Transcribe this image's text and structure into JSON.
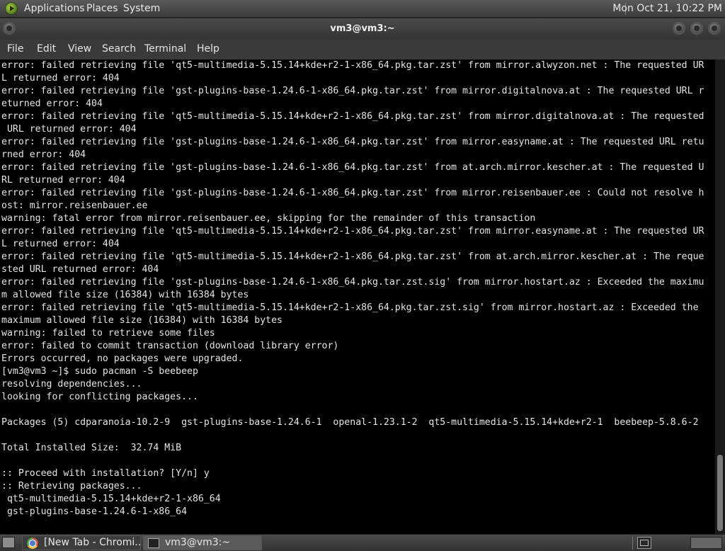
{
  "top_panel": {
    "menus": [
      "Applications",
      "Places",
      "System"
    ],
    "clock": "Mon Oct 21, 10:22 PM"
  },
  "window": {
    "title": "vm3@vm3:~"
  },
  "menubar": {
    "items": [
      "File",
      "Edit",
      "View",
      "Search",
      "Terminal",
      "Help"
    ]
  },
  "terminal": {
    "lines": [
      "error: failed retrieving file 'qt5-multimedia-5.15.14+kde+r2-1-x86_64.pkg.tar.zst' from mirror.alwyzon.net : The requested UR",
      "L returned error: 404",
      "error: failed retrieving file 'gst-plugins-base-1.24.6-1-x86_64.pkg.tar.zst' from mirror.digitalnova.at : The requested URL r",
      "eturned error: 404",
      "error: failed retrieving file 'qt5-multimedia-5.15.14+kde+r2-1-x86_64.pkg.tar.zst' from mirror.digitalnova.at : The requested",
      " URL returned error: 404",
      "error: failed retrieving file 'gst-plugins-base-1.24.6-1-x86_64.pkg.tar.zst' from mirror.easyname.at : The requested URL retu",
      "rned error: 404",
      "error: failed retrieving file 'gst-plugins-base-1.24.6-1-x86_64.pkg.tar.zst' from at.arch.mirror.kescher.at : The requested U",
      "RL returned error: 404",
      "error: failed retrieving file 'gst-plugins-base-1.24.6-1-x86_64.pkg.tar.zst' from mirror.reisenbauer.ee : Could not resolve h",
      "ost: mirror.reisenbauer.ee",
      "warning: fatal error from mirror.reisenbauer.ee, skipping for the remainder of this transaction",
      "error: failed retrieving file 'qt5-multimedia-5.15.14+kde+r2-1-x86_64.pkg.tar.zst' from mirror.easyname.at : The requested UR",
      "L returned error: 404",
      "error: failed retrieving file 'qt5-multimedia-5.15.14+kde+r2-1-x86_64.pkg.tar.zst' from at.arch.mirror.kescher.at : The reque",
      "sted URL returned error: 404",
      "error: failed retrieving file 'gst-plugins-base-1.24.6-1-x86_64.pkg.tar.zst.sig' from mirror.hostart.az : Exceeded the maximu",
      "m allowed file size (16384) with 16384 bytes",
      "error: failed retrieving file 'qt5-multimedia-5.15.14+kde+r2-1-x86_64.pkg.tar.zst.sig' from mirror.hostart.az : Exceeded the",
      "maximum allowed file size (16384) with 16384 bytes",
      "warning: failed to retrieve some files",
      "error: failed to commit transaction (download library error)",
      "Errors occurred, no packages were upgraded.",
      "[vm3@vm3 ~]$ sudo pacman -S beebeep",
      "resolving dependencies...",
      "looking for conflicting packages...",
      "",
      "Packages (5) cdparanoia-10.2-9  gst-plugins-base-1.24.6-1  openal-1.23.1-2  qt5-multimedia-5.15.14+kde+r2-1  beebeep-5.8.6-2",
      "",
      "Total Installed Size:  32.74 MiB",
      "",
      ":: Proceed with installation? [Y/n] y",
      ":: Retrieving packages...",
      " qt5-multimedia-5.15.14+kde+r2-1-x86_64",
      " gst-plugins-base-1.24.6-1-x86_64"
    ]
  },
  "taskbar": {
    "tasks": [
      {
        "label": "[New Tab - Chromi...",
        "icon": "chromium-icon"
      },
      {
        "label": "vm3@vm3:~",
        "icon": "terminal-icon"
      }
    ]
  }
}
